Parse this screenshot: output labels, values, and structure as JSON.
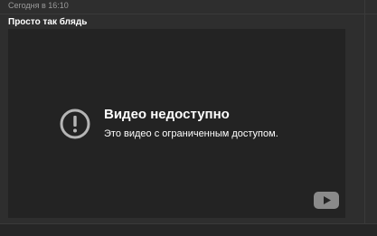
{
  "post": {
    "timestamp": "Сегодня в 16:10",
    "caption": "Просто так блядь"
  },
  "video": {
    "error_title": "Видео недоступно",
    "error_message": "Это видео с ограниченным доступом.",
    "error_icon": "exclamation-circle-icon",
    "brand_icon": "youtube-icon"
  },
  "colors": {
    "page_bg": "#2e2e2e",
    "video_bg": "#232323",
    "text_primary": "#ffffff",
    "text_muted": "#9a9a9a",
    "icon_gray": "#b5b5b5"
  }
}
